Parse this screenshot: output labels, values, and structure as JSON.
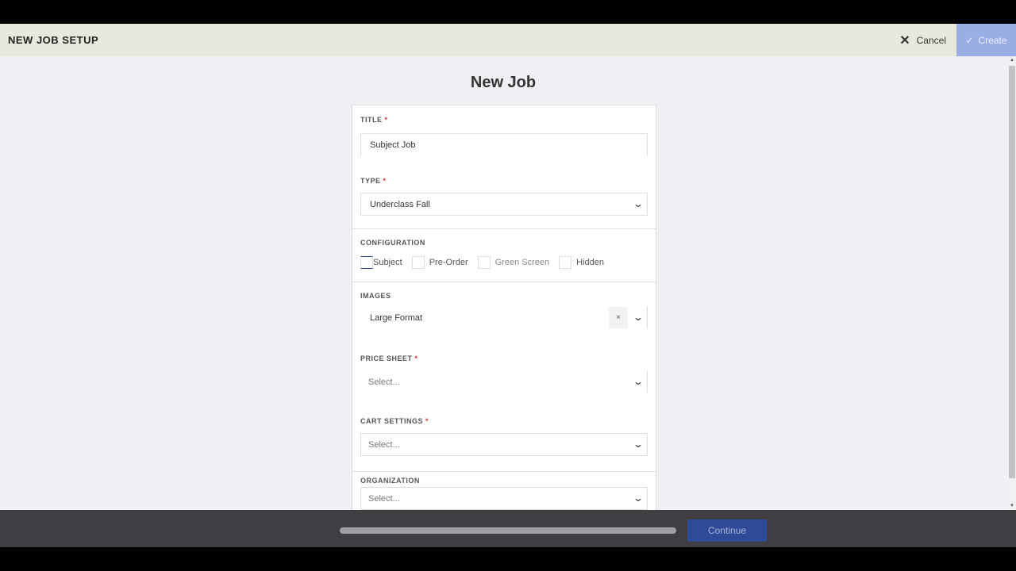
{
  "header": {
    "title": "NEW JOB SETUP",
    "cancel_label": "Cancel",
    "create_label": "Create"
  },
  "page_title": "New Job",
  "form": {
    "title": {
      "label": "TITLE",
      "value": "Subject Job"
    },
    "type": {
      "label": "TYPE",
      "value": "Underclass Fall"
    },
    "configuration": {
      "label": "CONFIGURATION",
      "options": [
        "Subject",
        "Pre-Order",
        "Green Screen",
        "Hidden"
      ]
    },
    "images": {
      "label": "IMAGES",
      "value": "Large Format",
      "clear": "×"
    },
    "price_sheet": {
      "label": "PRICE SHEET",
      "placeholder": "Select..."
    },
    "cart_settings": {
      "label": "CART SETTINGS",
      "placeholder": "Select..."
    },
    "organization": {
      "label": "ORGANIZATION",
      "placeholder": "Select..."
    },
    "required_mark": "*"
  },
  "footer": {
    "continue_label": "Continue",
    "progress": 1.0
  }
}
